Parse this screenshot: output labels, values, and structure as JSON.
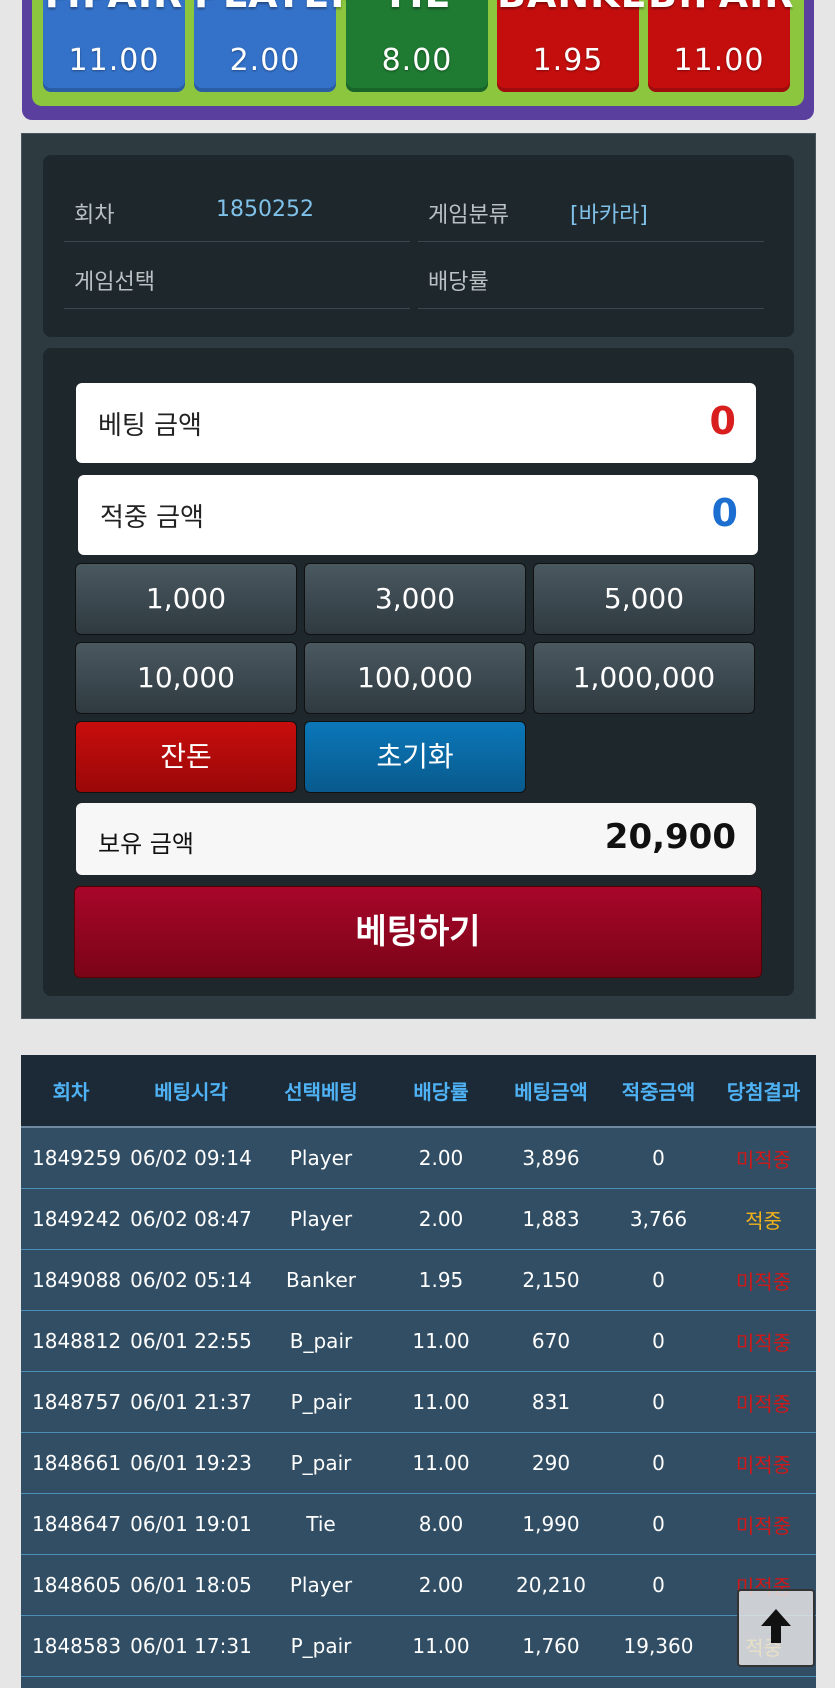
{
  "odds": [
    {
      "label": "P.PAIR",
      "value": "11.00",
      "color": "#3472c9"
    },
    {
      "label": "PLAYER",
      "value": "2.00",
      "color": "#3472c9"
    },
    {
      "label": "TIE",
      "value": "8.00",
      "color": "#1f7a32"
    },
    {
      "label": "BANKER",
      "value": "1.95",
      "color": "#c40e0e"
    },
    {
      "label": "B.PAIR",
      "value": "11.00",
      "color": "#c40e0e"
    }
  ],
  "info": {
    "round_label": "회차",
    "round_value": "1850252",
    "category_label": "게임분류",
    "category_value": "[바카라]",
    "selection_label": "게임선택",
    "selection_value": "",
    "rate_label": "배당률",
    "rate_value": ""
  },
  "bet": {
    "bet_amount_label": "베팅 금액",
    "bet_amount_value": "0",
    "win_amount_label": "적중 금액",
    "win_amount_value": "0",
    "chips": [
      "1,000",
      "3,000",
      "5,000",
      "10,000",
      "100,000",
      "1,000,000"
    ],
    "balance_button": "잔돈",
    "reset_button": "초기화",
    "owned_label": "보유 금액",
    "owned_value": "20,900",
    "submit_label": "베팅하기"
  },
  "history": {
    "headers": [
      "회차",
      "베팅시각",
      "선택베팅",
      "배당률",
      "베팅금액",
      "적중금액",
      "당첨결과"
    ],
    "rows": [
      [
        "1849259",
        "06/02 09:14",
        "Player",
        "2.00",
        "3,896",
        "0",
        "미적중"
      ],
      [
        "1849242",
        "06/02 08:47",
        "Player",
        "2.00",
        "1,883",
        "3,766",
        "적중"
      ],
      [
        "1849088",
        "06/02 05:14",
        "Banker",
        "1.95",
        "2,150",
        "0",
        "미적중"
      ],
      [
        "1848812",
        "06/01 22:55",
        "B_pair",
        "11.00",
        "670",
        "0",
        "미적중"
      ],
      [
        "1848757",
        "06/01 21:37",
        "P_pair",
        "11.00",
        "831",
        "0",
        "미적중"
      ],
      [
        "1848661",
        "06/01 19:23",
        "P_pair",
        "11.00",
        "290",
        "0",
        "미적중"
      ],
      [
        "1848647",
        "06/01 19:01",
        "Tie",
        "8.00",
        "1,990",
        "0",
        "미적중"
      ],
      [
        "1848605",
        "06/01 18:05",
        "Player",
        "2.00",
        "20,210",
        "0",
        "미적중"
      ],
      [
        "1848583",
        "06/01 17:31",
        "P_pair",
        "11.00",
        "1,760",
        "19,360",
        "적중"
      ]
    ]
  },
  "colors": {
    "lose": "#d01818",
    "win": "#f2b21a",
    "bet_amount": "#d81e1e",
    "win_amount": "#1c6fd1"
  },
  "icons": {
    "scroll_top": "arrow-up-icon"
  }
}
